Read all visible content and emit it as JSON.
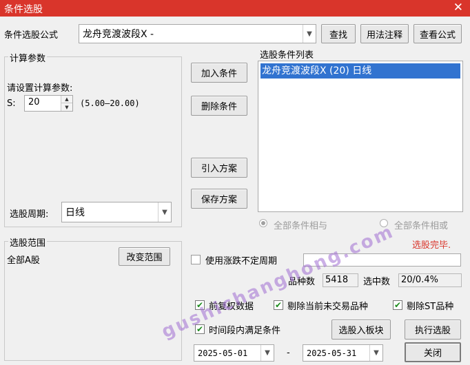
{
  "window": {
    "title": "条件选股",
    "close_glyph": "✕"
  },
  "formula": {
    "label": "条件选股公式",
    "value": "龙舟竞渡波段X  -",
    "find_button": "查找",
    "usage_button": "用法注释",
    "view_button": "查看公式"
  },
  "params": {
    "group_title": "计算参数",
    "prompt": "请设置计算参数:",
    "s_label": "S:",
    "s_value": "20",
    "s_range": "(5.00—20.00)",
    "period_label": "选股周期:",
    "period_value": "日线"
  },
  "condition_buttons": {
    "add": "加入条件",
    "delete": "删除条件",
    "import": "引入方案",
    "save": "保存方案"
  },
  "condition_list": {
    "title": "选股条件列表",
    "items": [
      "龙舟竞渡波段X (20) 日线"
    ],
    "and_option": "全部条件相与",
    "or_option": "全部条件相或"
  },
  "status": {
    "text": "选股完毕.",
    "color": "#d9352b"
  },
  "scope": {
    "group_title": "选股范围",
    "value": "全部A股",
    "change_button": "改变范围"
  },
  "uncertain_period": {
    "label": "使用涨跌不定周期",
    "checked": false,
    "value": ""
  },
  "stats": {
    "count_label": "品种数",
    "count_value": "5418",
    "selected_label": "选中数",
    "selected_value": "20/0.4%"
  },
  "options": {
    "pre_adjust": "前复权数据",
    "exclude_untraded": "剔除当前未交易品种",
    "exclude_st": "剔除ST品种",
    "time_range": "时间段内满足条件"
  },
  "actions": {
    "to_block": "选股入板块",
    "execute": "执行选股",
    "close": "关闭"
  },
  "dates": {
    "start": "2025-05-01",
    "separator": "-",
    "end": "2025-05-31"
  },
  "watermark": "gushichanghong.com"
}
